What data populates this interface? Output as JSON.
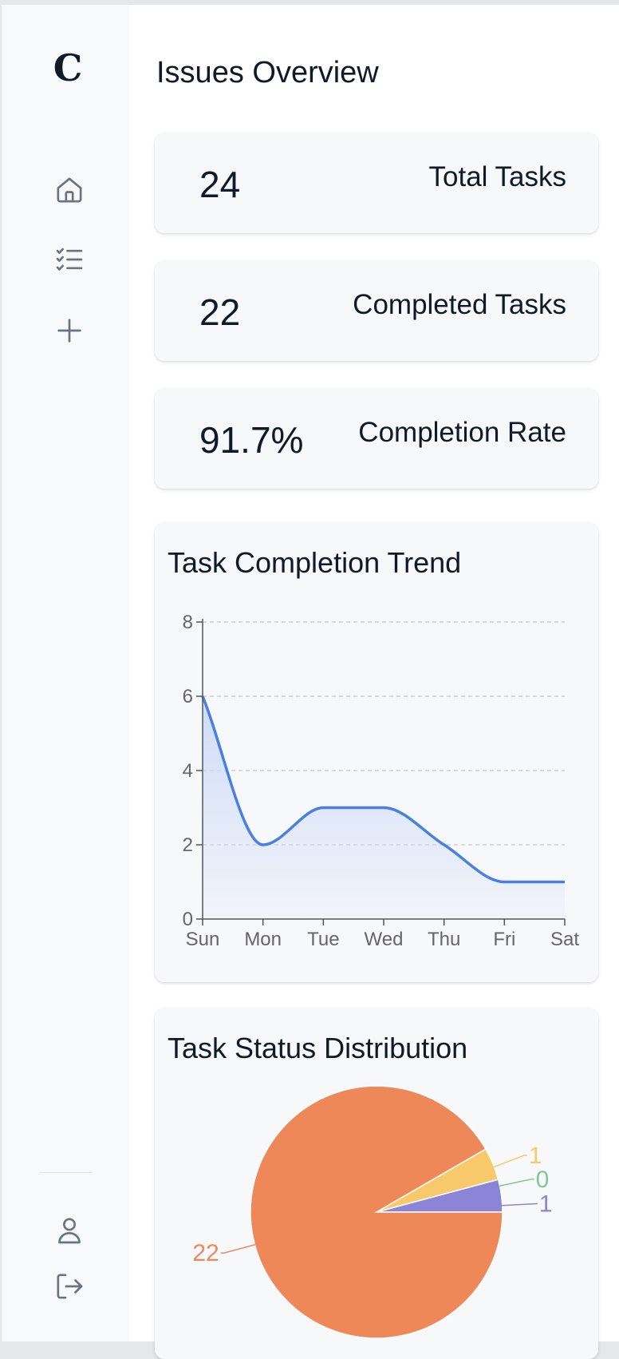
{
  "sidebar": {
    "logo": "C",
    "nav": [
      {
        "icon": "home-icon"
      },
      {
        "icon": "task-list-icon"
      },
      {
        "icon": "plus-icon"
      }
    ],
    "bottom": [
      {
        "icon": "user-icon"
      },
      {
        "icon": "logout-icon"
      }
    ]
  },
  "header": {
    "title": "Issues Overview"
  },
  "stats": {
    "total": {
      "value": "24",
      "label": "Total Tasks"
    },
    "completed": {
      "value": "22",
      "label": "Completed Tasks"
    },
    "rate": {
      "value": "91.7%",
      "label": "Completion Rate"
    }
  },
  "colors": {
    "line": "#4a7fe3",
    "area_top": "#cfdcf7",
    "grid": "#c8c8cc",
    "axis": "#555555",
    "pie_orange": "#ef8859",
    "pie_yellow": "#f7c96a",
    "pie_green": "#7fc79a",
    "pie_purple": "#8b84d7"
  },
  "chart_data": [
    {
      "type": "area",
      "title": "Task Completion Trend",
      "categories": [
        "Sun",
        "Mon",
        "Tue",
        "Wed",
        "Thu",
        "Fri",
        "Sat"
      ],
      "series": [
        {
          "values": [
            6,
            2,
            3,
            3,
            2,
            1,
            1
          ]
        }
      ],
      "ylim": [
        0,
        8
      ],
      "yticks": [
        0,
        2,
        4,
        6,
        8
      ],
      "grid": true,
      "xlabel": "",
      "ylabel": ""
    },
    {
      "type": "pie",
      "title": "Task Status Distribution",
      "slices": [
        {
          "value": 22,
          "label": "22",
          "color": "#ef8859"
        },
        {
          "value": 1,
          "label": "1",
          "color": "#f7c96a"
        },
        {
          "value": 0,
          "label": "0",
          "color": "#7fc79a"
        },
        {
          "value": 1,
          "label": "1",
          "color": "#8b84d7"
        }
      ]
    }
  ]
}
